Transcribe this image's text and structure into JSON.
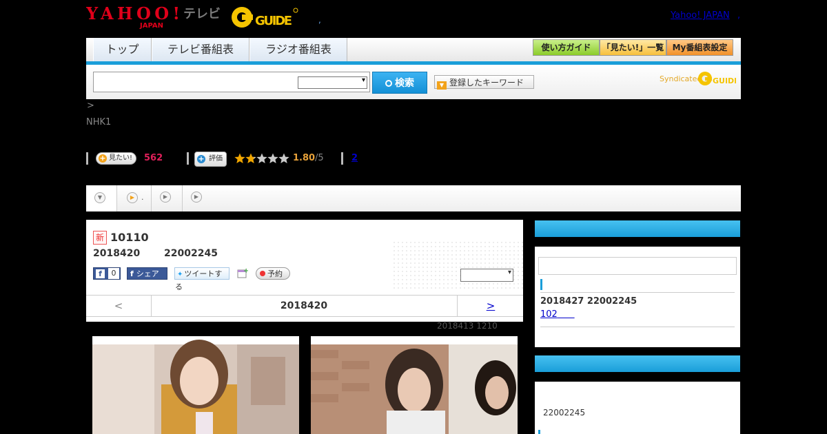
{
  "header": {
    "logo_yahoo": "YAHOO! JAPAN",
    "logo_tv": "テレビ",
    "logo_gguide": "G GUIDE",
    "yahoo_japan_link": "Yahoo! JAPAN",
    "yahoo_japan_sep": ",",
    "dot": ","
  },
  "nav": {
    "tabs": [
      "トップ",
      "テレビ番組表",
      "ラジオ番組表"
    ],
    "utility": [
      "使い方ガイド",
      "「見たい!」一覧",
      "My番組表設定"
    ]
  },
  "search": {
    "input_value": "",
    "button_label": "検索",
    "keyword_button": "登録したキーワード",
    "syndicated": "Syndicated"
  },
  "info": {
    "breadcrumb_arrow": ">",
    "channel": "NHK1"
  },
  "ratings": {
    "want_label": "見たい!",
    "want_count": "562",
    "review_label": "評価",
    "stars": 1.8,
    "score": "1.80",
    "score_max": "/5",
    "link_count": "2"
  },
  "tabs_row": {
    "tab2_dot": "."
  },
  "program": {
    "new_badge": "新",
    "title": "10110",
    "date": "2018420",
    "time": "22002245",
    "fb_count": "0",
    "share_label": "シェア",
    "tweet_label": "ツイートする",
    "reserve_label": "予約",
    "date_prev": "<",
    "date_center": "2018420",
    "date_next": ">"
  },
  "updated_note": "2018413  1210",
  "sidebar": {
    "box1": {
      "date_line": "2018427  22002245",
      "link": "102"
    },
    "box2": {
      "time": "22002245"
    }
  },
  "colors": {
    "accent": "#1a9ed9",
    "want": "#e0205a",
    "score": "#e8a23a"
  }
}
